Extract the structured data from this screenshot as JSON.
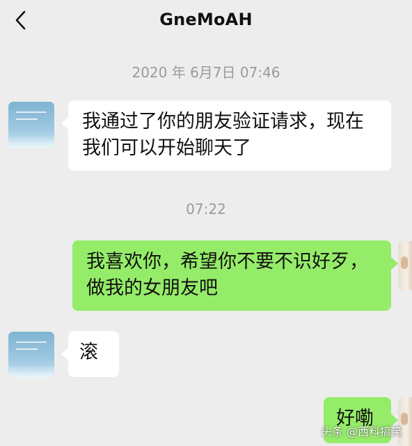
{
  "header": {
    "title": "GneMoAH"
  },
  "messages": {
    "ts1": "2020 年 6月7日 07:46",
    "m1": {
      "line1": "我通过了你的朋友验证请求，现在",
      "line2": "我们可以开始聊天了"
    },
    "ts2": "07:22",
    "m2": {
      "line1": "我喜欢你，希望你不要不识好歹，",
      "line2": "做我的女朋友吧"
    },
    "m3": "滚",
    "m4": "好嘞"
  },
  "watermark": "头条 @西料搞笑",
  "colors": {
    "background": "#ededed",
    "incoming_bubble": "#ffffff",
    "outgoing_bubble": "#95ec69",
    "timestamp": "#9a9a9a"
  },
  "icons": {
    "back": "chevron-left-icon"
  }
}
